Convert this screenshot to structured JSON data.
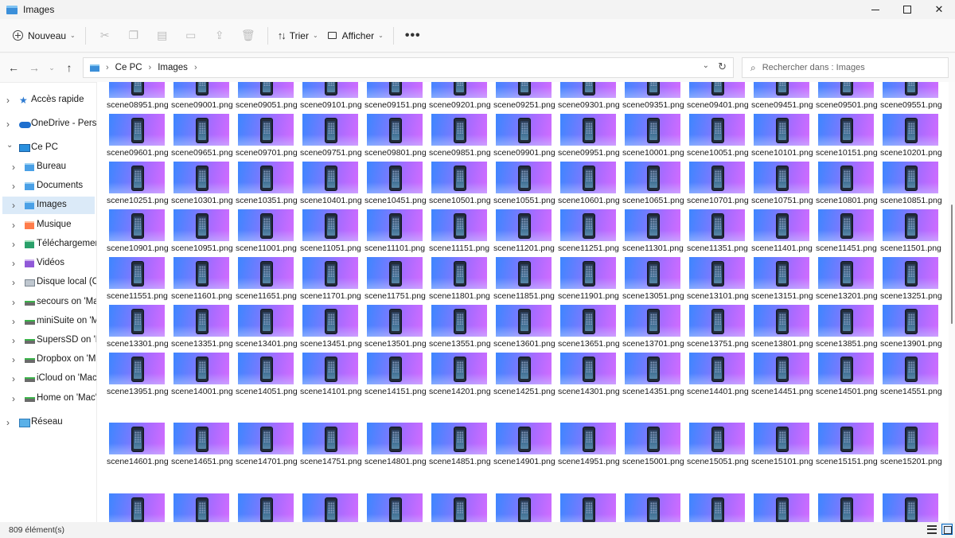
{
  "window": {
    "title": "Images",
    "minimize_label": "",
    "maximize_label": "",
    "close_label": "✕"
  },
  "toolbar": {
    "new_label": "Nouveau",
    "sort_label": "Trier",
    "view_label": "Afficher",
    "more_label": "•••",
    "tool_icons": [
      "scissors-icon",
      "copy-icon",
      "paste-icon",
      "rename-icon",
      "share-icon",
      "delete-icon"
    ]
  },
  "navigation": {
    "breadcrumb": [
      "Ce PC",
      "Images"
    ],
    "search_placeholder": "Rechercher dans : Images"
  },
  "sidebar": {
    "items": [
      {
        "label": "Accès rapide",
        "icon": "star-icon",
        "level": 0,
        "expanded": false
      },
      {
        "label": "OneDrive - Personal",
        "icon": "cloud-icon",
        "level": 0,
        "expanded": false
      },
      {
        "label": "Ce PC",
        "icon": "pc-icon",
        "level": 0,
        "expanded": true
      },
      {
        "label": "Bureau",
        "icon": "folder-icon",
        "level": 1,
        "expanded": false
      },
      {
        "label": "Documents",
        "icon": "folder-icon",
        "level": 1,
        "expanded": false
      },
      {
        "label": "Images",
        "icon": "folder-icon",
        "level": 1,
        "expanded": false,
        "selected": true
      },
      {
        "label": "Musique",
        "icon": "music-folder-icon",
        "level": 1,
        "expanded": false
      },
      {
        "label": "Téléchargements",
        "icon": "download-folder-icon",
        "level": 1,
        "expanded": false
      },
      {
        "label": "Vidéos",
        "icon": "video-folder-icon",
        "level": 1,
        "expanded": false
      },
      {
        "label": "Disque local (C:)",
        "icon": "disk-icon",
        "level": 1,
        "expanded": false
      },
      {
        "label": "secours on 'Mac' (",
        "icon": "network-drive-icon",
        "level": 1,
        "expanded": false
      },
      {
        "label": "miniSuite on 'Mac",
        "icon": "network-drive-icon",
        "level": 1,
        "expanded": false
      },
      {
        "label": "SupersSD on 'Mac'",
        "icon": "network-drive-icon",
        "level": 1,
        "expanded": false
      },
      {
        "label": "Dropbox on 'Mac'",
        "icon": "network-drive-icon",
        "level": 1,
        "expanded": false
      },
      {
        "label": "iCloud on 'Mac' (Y",
        "icon": "network-drive-icon",
        "level": 1,
        "expanded": false
      },
      {
        "label": "Home on 'Mac' (Z",
        "icon": "network-drive-icon",
        "level": 1,
        "expanded": false
      },
      {
        "label": "Réseau",
        "icon": "network-icon",
        "level": 0,
        "expanded": false
      }
    ]
  },
  "files": {
    "rows": [
      [
        "scene08951.png",
        "scene09001.png",
        "scene09051.png",
        "scene09101.png",
        "scene09151.png",
        "scene09201.png",
        "scene09251.png",
        "scene09301.png",
        "scene09351.png",
        "scene09401.png",
        "scene09451.png",
        "scene09501.png",
        "scene09551.png"
      ],
      [
        "scene09601.png",
        "scene09651.png",
        "scene09701.png",
        "scene09751.png",
        "scene09801.png",
        "scene09851.png",
        "scene09901.png",
        "scene09951.png",
        "scene10001.png",
        "scene10051.png",
        "scene10101.png",
        "scene10151.png",
        "scene10201.png"
      ],
      [
        "scene10251.png",
        "scene10301.png",
        "scene10351.png",
        "scene10401.png",
        "scene10451.png",
        "scene10501.png",
        "scene10551.png",
        "scene10601.png",
        "scene10651.png",
        "scene10701.png",
        "scene10751.png",
        "scene10801.png",
        "scene10851.png"
      ],
      [
        "scene10901.png",
        "scene10951.png",
        "scene11001.png",
        "scene11051.png",
        "scene11101.png",
        "scene11151.png",
        "scene11201.png",
        "scene11251.png",
        "scene11301.png",
        "scene11351.png",
        "scene11401.png",
        "scene11451.png",
        "scene11501.png"
      ],
      [
        "scene11551.png",
        "scene11601.png",
        "scene11651.png",
        "scene11701.png",
        "scene11751.png",
        "scene11801.png",
        "scene11851.png",
        "scene11901.png",
        "scene13051.png",
        "scene13101.png",
        "scene13151.png",
        "scene13201.png",
        "scene13251.png"
      ],
      [
        "scene13301.png",
        "scene13351.png",
        "scene13401.png",
        "scene13451.png",
        "scene13501.png",
        "scene13551.png",
        "scene13601.png",
        "scene13651.png",
        "scene13701.png",
        "scene13751.png",
        "scene13801.png",
        "scene13851.png",
        "scene13901.png"
      ],
      [
        "scene13951.png",
        "scene14001.png",
        "scene14051.png",
        "scene14101.png",
        "scene14151.png",
        "scene14201.png",
        "scene14251.png",
        "scene14301.png",
        "scene14351.png",
        "scene14401.png",
        "scene14451.png",
        "scene14501.png",
        "scene14551.png"
      ],
      [
        "scene14601.png",
        "scene14651.png",
        "scene14701.png",
        "scene14751.png",
        "scene14801.png",
        "scene14851.png",
        "scene14901.png",
        "scene14951.png",
        "scene15001.png",
        "scene15051.png",
        "scene15101.png",
        "scene15151.png",
        "scene15201.png"
      ],
      [
        "",
        "",
        "",
        "",
        "",
        "",
        "",
        "",
        "",
        "",
        "",
        "",
        ""
      ]
    ]
  },
  "status": {
    "item_count": "809 élément(s)"
  },
  "colors": {
    "accent": "#0067c0",
    "selected_bg": "#dbeaf8",
    "thumb_gradient_start": "#3d86ff",
    "thumb_gradient_end": "#d36cff"
  }
}
